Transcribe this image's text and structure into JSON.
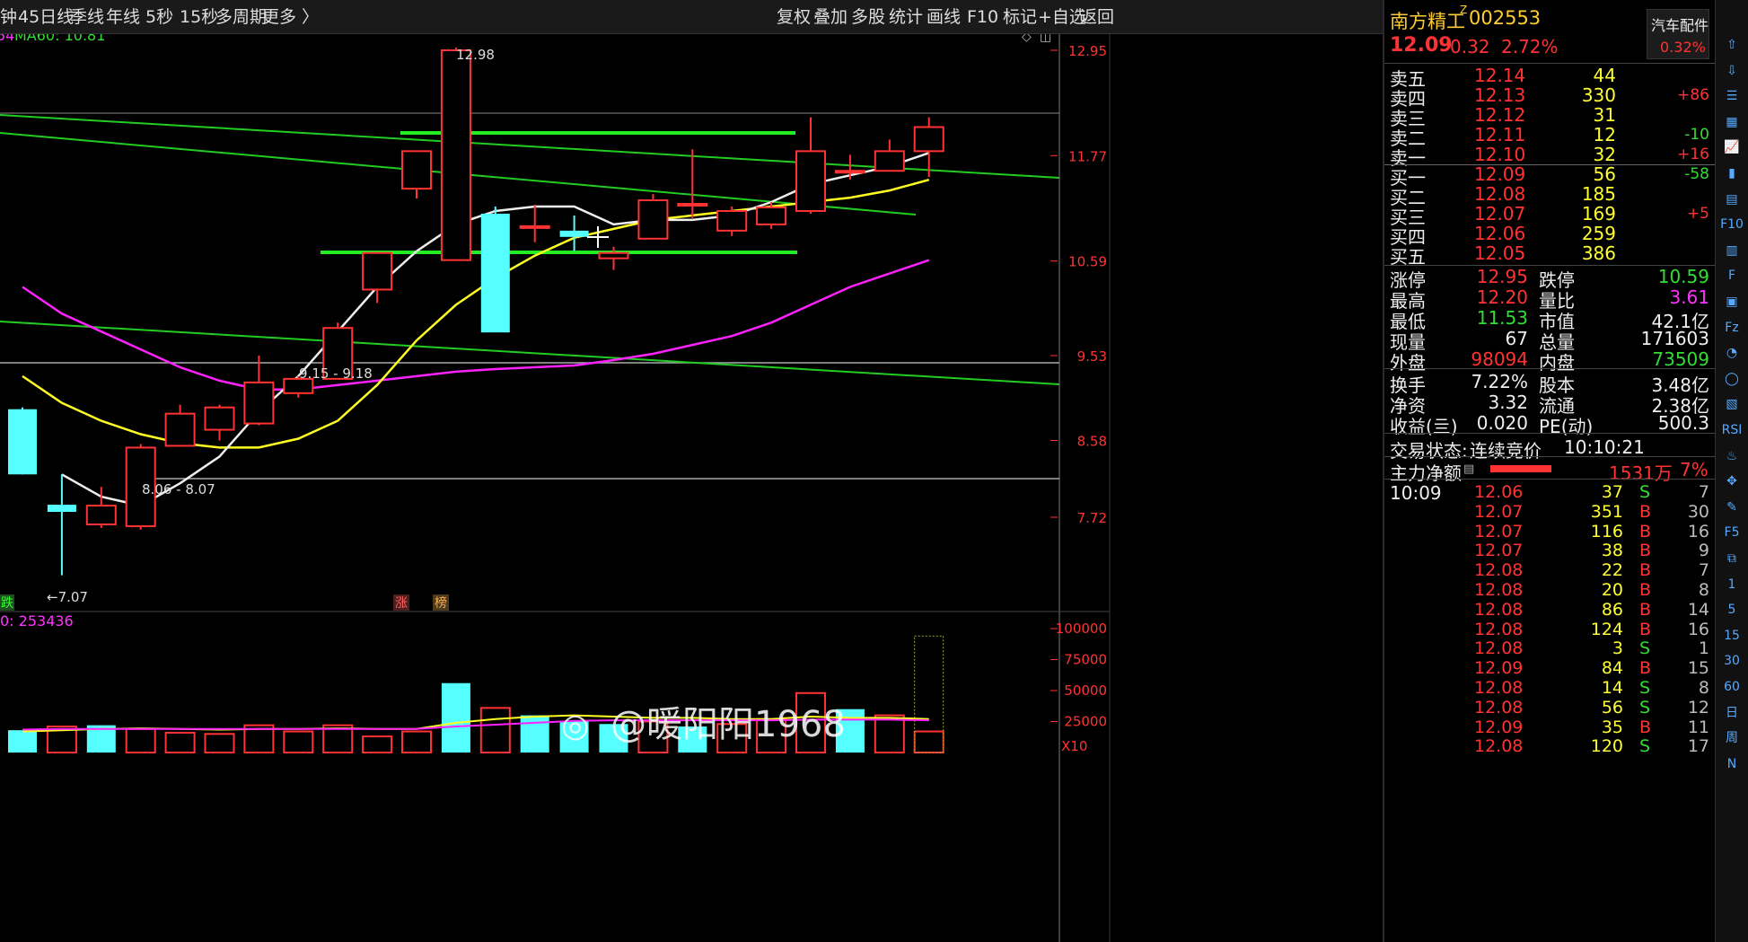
{
  "toolbar": {
    "left_items": [
      "钟",
      "45日线",
      "季线",
      "年线",
      "5秒",
      "15秒",
      "多周期",
      "更多 〉"
    ],
    "right_items": [
      "复权",
      "叠加",
      "多股",
      "统计",
      "画线",
      "F10",
      "标记",
      "+自选",
      "返回"
    ]
  },
  "indicator": {
    "ma_label_left": "54",
    "ma60_label": "MA60: 10.81",
    "vol_label": "0: 253436"
  },
  "price_axis": {
    "labels": [
      "12.95",
      "11.77",
      "10.59",
      "9.53",
      "8.58",
      "7.72"
    ]
  },
  "volume_axis": {
    "labels": [
      "100000",
      "75000",
      "50000",
      "25000"
    ],
    "multiplier": "X10"
  },
  "annotations": {
    "high": "12.98",
    "low": "←7.07",
    "range1": "9.15 - 9.18",
    "range2": "8.06 - 8.07",
    "tag_die": "跌",
    "tag_zhang": "涨",
    "tag_bang": "榜"
  },
  "watermark": "@暖阳阳1968",
  "stock": {
    "name": "南方精工",
    "flag": "Z",
    "code": "002553",
    "price": "12.09",
    "change": "0.32",
    "pct": "2.72%",
    "sector": "汽车配件",
    "sector_pct": "0.32%"
  },
  "asks": [
    {
      "label": "卖五",
      "price": "12.14",
      "vol": "44",
      "chg": ""
    },
    {
      "label": "卖四",
      "price": "12.13",
      "vol": "330",
      "chg": "+86"
    },
    {
      "label": "卖三",
      "price": "12.12",
      "vol": "31",
      "chg": ""
    },
    {
      "label": "卖二",
      "price": "12.11",
      "vol": "12",
      "chg": "-10"
    },
    {
      "label": "卖一",
      "price": "12.10",
      "vol": "32",
      "chg": "+16"
    }
  ],
  "bids": [
    {
      "label": "买一",
      "price": "12.09",
      "vol": "56",
      "chg": "-58"
    },
    {
      "label": "买二",
      "price": "12.08",
      "vol": "185",
      "chg": ""
    },
    {
      "label": "买三",
      "price": "12.07",
      "vol": "169",
      "chg": "+5"
    },
    {
      "label": "买四",
      "price": "12.06",
      "vol": "259",
      "chg": ""
    },
    {
      "label": "买五",
      "price": "12.05",
      "vol": "386",
      "chg": ""
    }
  ],
  "stats": [
    {
      "l1": "涨停",
      "v1": "12.95",
      "c1": "red",
      "l2": "跌停",
      "v2": "10.59",
      "c2": "green"
    },
    {
      "l1": "最高",
      "v1": "12.20",
      "c1": "red",
      "l2": "量比",
      "v2": "3.61",
      "c2": "purple"
    },
    {
      "l1": "最低",
      "v1": "11.53",
      "c1": "green",
      "l2": "市值",
      "v2": "42.1亿",
      "c2": "white"
    },
    {
      "l1": "现量",
      "v1": "67",
      "c1": "white",
      "l2": "总量",
      "v2": "171603",
      "c2": "white"
    },
    {
      "l1": "外盘",
      "v1": "98094",
      "c1": "red",
      "l2": "内盘",
      "v2": "73509",
      "c2": "green"
    }
  ],
  "stats2": [
    {
      "l1": "换手",
      "v1": "7.22%",
      "l2": "股本",
      "v2": "3.48亿"
    },
    {
      "l1": "净资",
      "v1": "3.32",
      "l2": "流通",
      "v2": "2.38亿"
    },
    {
      "l1": "收益(亖)",
      "v1": "0.020",
      "l2": "PE(动)",
      "v2": "500.3"
    }
  ],
  "trade_status": {
    "label": "交易状态:",
    "value": "连续竞价",
    "time": "10:10:21"
  },
  "main_flow": {
    "label": "主力净额",
    "value": "1531万",
    "pct": "7%",
    "bar_fraction": 0.45
  },
  "ticks_time": "10:09",
  "ticks": [
    {
      "p": "12.06",
      "v": "37",
      "s": "S",
      "n": "7"
    },
    {
      "p": "12.07",
      "v": "351",
      "s": "B",
      "n": "30"
    },
    {
      "p": "12.07",
      "v": "116",
      "s": "B",
      "n": "16"
    },
    {
      "p": "12.07",
      "v": "38",
      "s": "B",
      "n": "9"
    },
    {
      "p": "12.08",
      "v": "22",
      "s": "B",
      "n": "7"
    },
    {
      "p": "12.08",
      "v": "20",
      "s": "B",
      "n": "8"
    },
    {
      "p": "12.08",
      "v": "86",
      "s": "B",
      "n": "14"
    },
    {
      "p": "12.08",
      "v": "124",
      "s": "B",
      "n": "16"
    },
    {
      "p": "12.08",
      "v": "3",
      "s": "S",
      "n": "1"
    },
    {
      "p": "12.09",
      "v": "84",
      "s": "B",
      "n": "15"
    },
    {
      "p": "12.08",
      "v": "14",
      "s": "S",
      "n": "8"
    },
    {
      "p": "12.08",
      "v": "56",
      "s": "S",
      "n": "12"
    },
    {
      "p": "12.09",
      "v": "35",
      "s": "B",
      "n": "11"
    },
    {
      "p": "12.08",
      "v": "120",
      "s": "S",
      "n": "17"
    }
  ],
  "right_icons": [
    "up-arrow",
    "down-arrow",
    "list",
    "table",
    "line-chart",
    "candle",
    "news",
    "F10",
    "chart",
    "F",
    "square",
    "Fz",
    "circle-chart",
    "circle",
    "chart2",
    "RSI",
    "flame",
    "move",
    "pencil",
    "F5",
    "share",
    "1",
    "5",
    "15",
    "30",
    "60",
    "日",
    "周",
    "N"
  ],
  "right_texts": [
    "F10",
    "Fz",
    "RSI",
    "F5",
    "1",
    "5",
    "15",
    "30",
    "60",
    "日",
    "周",
    "N"
  ],
  "candles": [
    {
      "o": 8.93,
      "c": 8.2,
      "h": 8.95,
      "l": 8.2
    },
    {
      "o": 7.86,
      "c": 7.78,
      "h": 8.2,
      "l": 7.07
    },
    {
      "o": 7.64,
      "c": 7.85,
      "h": 8.06,
      "l": 7.6
    },
    {
      "o": 7.62,
      "c": 8.5,
      "h": 8.54,
      "l": 7.58
    },
    {
      "o": 8.52,
      "c": 8.88,
      "h": 8.98,
      "l": 8.52
    },
    {
      "o": 8.7,
      "c": 8.95,
      "h": 8.98,
      "l": 8.58
    },
    {
      "o": 8.77,
      "c": 9.23,
      "h": 9.53,
      "l": 8.75
    },
    {
      "o": 9.11,
      "c": 9.27,
      "h": 9.3,
      "l": 9.06
    },
    {
      "o": 9.27,
      "c": 9.84,
      "h": 9.9,
      "l": 9.27
    },
    {
      "o": 10.27,
      "c": 10.68,
      "h": 10.68,
      "l": 10.12
    },
    {
      "o": 11.4,
      "c": 11.82,
      "h": 11.82,
      "l": 11.29
    },
    {
      "o": 10.6,
      "c": 12.95,
      "h": 12.98,
      "l": 10.6
    },
    {
      "o": 11.12,
      "c": 9.79,
      "h": 11.2,
      "l": 9.79
    },
    {
      "o": 10.98,
      "c": 10.98,
      "h": 11.22,
      "l": 10.8
    },
    {
      "o": 10.93,
      "c": 10.86,
      "h": 11.1,
      "l": 10.7
    },
    {
      "o": 10.62,
      "c": 10.68,
      "h": 10.75,
      "l": 10.49
    },
    {
      "o": 10.84,
      "c": 11.27,
      "h": 11.34,
      "l": 10.84
    },
    {
      "o": 11.23,
      "c": 11.23,
      "h": 11.84,
      "l": 11.07
    },
    {
      "o": 10.93,
      "c": 11.15,
      "h": 11.2,
      "l": 10.87
    },
    {
      "o": 11.0,
      "c": 11.19,
      "h": 11.25,
      "l": 10.95
    },
    {
      "o": 11.15,
      "c": 11.82,
      "h": 12.2,
      "l": 11.12
    },
    {
      "o": 11.6,
      "c": 11.6,
      "h": 11.78,
      "l": 11.5
    },
    {
      "o": 11.6,
      "c": 11.82,
      "h": 11.95,
      "l": 11.6
    },
    {
      "o": 11.82,
      "c": 12.09,
      "h": 12.2,
      "l": 11.53
    }
  ],
  "volumes": [
    {
      "v": 18000,
      "up": false
    },
    {
      "v": 21000,
      "up": true
    },
    {
      "v": 22000,
      "up": false
    },
    {
      "v": 19000,
      "up": true
    },
    {
      "v": 16000,
      "up": true
    },
    {
      "v": 15000,
      "up": true
    },
    {
      "v": 22000,
      "up": true
    },
    {
      "v": 17000,
      "up": true
    },
    {
      "v": 22000,
      "up": true
    },
    {
      "v": 13000,
      "up": true
    },
    {
      "v": 17000,
      "up": true
    },
    {
      "v": 56000,
      "up": false
    },
    {
      "v": 36000,
      "up": true
    },
    {
      "v": 30000,
      "up": false
    },
    {
      "v": 25000,
      "up": false
    },
    {
      "v": 23000,
      "up": false
    },
    {
      "v": 25000,
      "up": true
    },
    {
      "v": 21000,
      "up": false
    },
    {
      "v": 23000,
      "up": true
    },
    {
      "v": 27000,
      "up": true
    },
    {
      "v": 48000,
      "up": true
    },
    {
      "v": 35000,
      "up": false
    },
    {
      "v": 30000,
      "up": true
    },
    {
      "v": 17000,
      "up": true
    }
  ],
  "vol_forecast": 94000,
  "ma_white": [
    null,
    8.2,
    7.95,
    7.85,
    8.1,
    8.4,
    8.9,
    9.3,
    9.8,
    10.3,
    10.7,
    11.0,
    11.15,
    11.2,
    11.2,
    11.0,
    11.05,
    11.05,
    11.1,
    11.25,
    11.45,
    11.55,
    11.65,
    11.8
  ],
  "ma_yellow": [
    9.3,
    9.0,
    8.8,
    8.65,
    8.55,
    8.5,
    8.5,
    8.6,
    8.8,
    9.2,
    9.7,
    10.1,
    10.4,
    10.65,
    10.85,
    10.95,
    11.05,
    11.1,
    11.15,
    11.2,
    11.25,
    11.3,
    11.38,
    11.5
  ],
  "ma_magenta": [
    10.3,
    10.0,
    9.8,
    9.6,
    9.4,
    9.25,
    9.15,
    9.15,
    9.2,
    9.25,
    9.3,
    9.35,
    9.38,
    9.4,
    9.42,
    9.48,
    9.55,
    9.65,
    9.75,
    9.9,
    10.1,
    10.3,
    10.45,
    10.6
  ]
}
